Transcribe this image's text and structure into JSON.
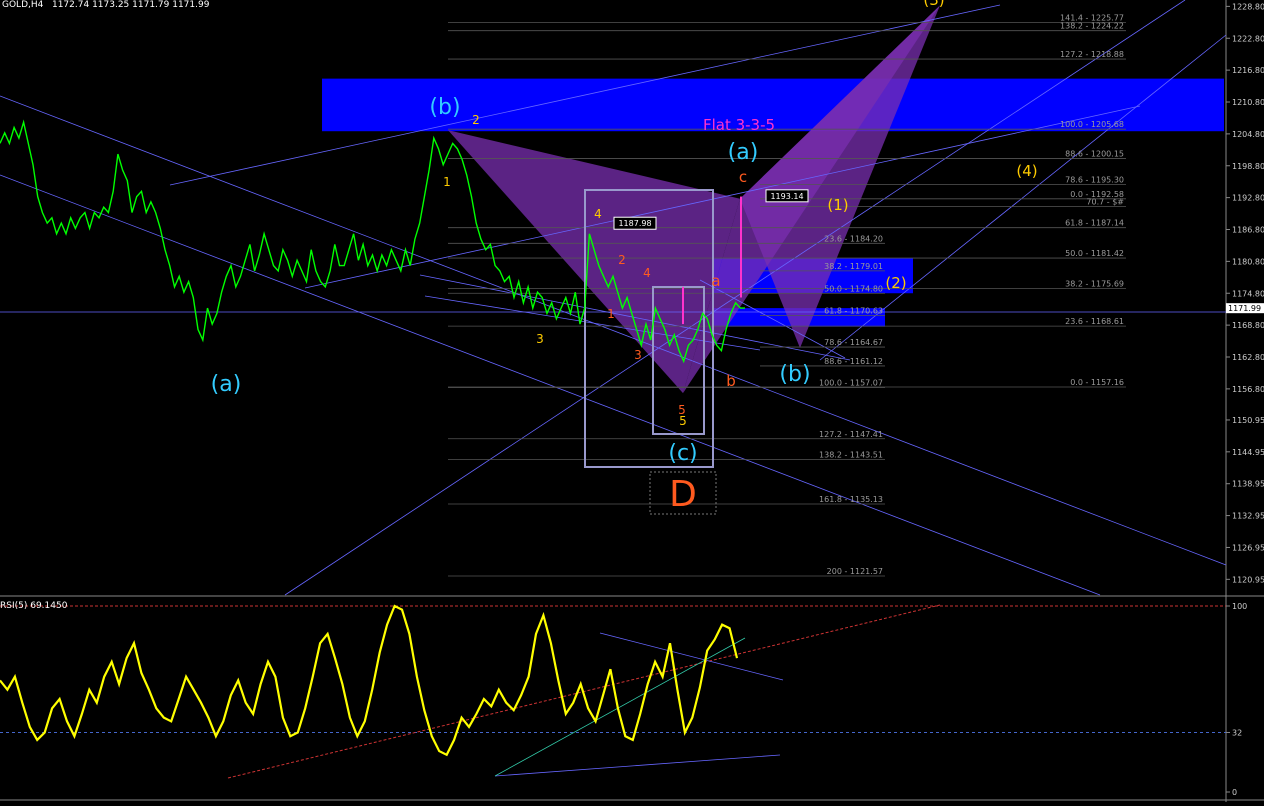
{
  "header": {
    "symbol": "GOLD,H4",
    "ohlc": "1172.74 1173.25 1171.79 1171.99"
  },
  "rsi_header": "RSI(5) 69.1450",
  "colors": {
    "background": "#000000",
    "price_line": "#00ff00",
    "rsi_line": "#ffff00",
    "trendline": "#6666ff",
    "harmonic_fill": "#7a2fb0",
    "supply_zone": "#0000ff",
    "fib_line": "#555555",
    "cyan_label": "#33ccff",
    "orange_label": "#ff5a1f",
    "yellow_label": "#ffcc00",
    "magenta_label": "#ff33cc"
  },
  "chart_data": [
    {
      "type": "line",
      "panel": "price",
      "ylim": [
        1118,
        1230
      ],
      "y_ticks": [
        "1228.80",
        "1222.80",
        "1216.80",
        "1210.80",
        "1204.80",
        "1198.80",
        "1192.80",
        "1186.80",
        "1180.80",
        "1174.80",
        "1168.80",
        "1162.80",
        "1156.80",
        "1150.95",
        "1144.95",
        "1138.95",
        "1132.95",
        "1126.95",
        "1120.95"
      ],
      "current_price": "1171.99",
      "series": [
        {
          "values": [
            1203,
            1205,
            1203,
            1206,
            1204,
            1207,
            1203,
            1199,
            1193,
            1190,
            1188,
            1189,
            1186,
            1188,
            1186,
            1189,
            1187,
            1189,
            1190,
            1187,
            1190,
            1189,
            1191,
            1190,
            1194,
            1201,
            1198,
            1196,
            1190,
            1193,
            1194,
            1190,
            1192,
            1190,
            1187,
            1183,
            1180,
            1176,
            1178,
            1175,
            1177,
            1174,
            1168,
            1166,
            1172,
            1169,
            1171,
            1175,
            1178,
            1180,
            1176,
            1178,
            1181,
            1184,
            1179,
            1182,
            1186,
            1183,
            1180,
            1179,
            1183,
            1181,
            1178,
            1181,
            1179,
            1177,
            1183,
            1179,
            1177,
            1176,
            1179,
            1184,
            1180,
            1180,
            1183,
            1186,
            1181,
            1184,
            1180,
            1182,
            1179,
            1182,
            1180,
            1183,
            1181,
            1179,
            1183,
            1180,
            1185,
            1188,
            1193,
            1198,
            1204,
            1202,
            1199,
            1201,
            1203,
            1202,
            1200,
            1197,
            1193,
            1188,
            1185,
            1183,
            1184,
            1180,
            1179,
            1177,
            1178,
            1174,
            1177,
            1173,
            1176,
            1172,
            1175,
            1174,
            1171,
            1173,
            1170,
            1172,
            1174,
            1171,
            1175,
            1169,
            1172,
            1186,
            1183,
            1180,
            1178,
            1176,
            1178,
            1175,
            1172,
            1174,
            1171,
            1168,
            1165,
            1169,
            1166,
            1172,
            1170,
            1168,
            1165,
            1167,
            1164,
            1162,
            1165,
            1166,
            1168,
            1171,
            1170,
            1167,
            1165,
            1164,
            1168,
            1171,
            1173,
            1172,
            1172
          ]
        }
      ],
      "fib_levels": [
        {
          "label": "141.4 - 1225.77",
          "value": 1225.77
        },
        {
          "label": "138.2 - 1224.22",
          "value": 1224.22
        },
        {
          "label": "127.2 - 1218.88",
          "value": 1218.88
        },
        {
          "label": "100.0 - 1205.68",
          "value": 1205.68
        },
        {
          "label": "88.6 - 1200.15",
          "value": 1200.15
        },
        {
          "label": "78.6 - 1195.30",
          "value": 1195.3
        },
        {
          "label": "0.0 - 1192.58",
          "value": 1192.58
        },
        {
          "label": "70.7 - $#",
          "value": 1191.1
        },
        {
          "label": "61.8 - 1187.14",
          "value": 1187.14
        },
        {
          "label": "23.6 - 1184.20",
          "value": 1184.2
        },
        {
          "label": "50.0 - 1181.42",
          "value": 1181.42
        },
        {
          "label": "38.2 - 1179.01",
          "value": 1179.01
        },
        {
          "label": "38.2 - 1175.69",
          "value": 1175.69
        },
        {
          "label": "50.0 - 1174.80",
          "value": 1174.8
        },
        {
          "label": "61.8 - 1170.63",
          "value": 1170.63
        },
        {
          "label": "23.6 - 1168.61",
          "value": 1168.61
        },
        {
          "label": "78.6 - 1164.67",
          "value": 1164.67
        },
        {
          "label": "88.6 - 1161.12",
          "value": 1161.12
        },
        {
          "label": "100.0 - 1157.07",
          "value": 1157.07
        },
        {
          "label": "0.0 - 1157.16",
          "value": 1157.16
        },
        {
          "label": "127.2 - 1147.41",
          "value": 1147.41
        },
        {
          "label": "138.2 - 1143.51",
          "value": 1143.51
        },
        {
          "label": "161.8 - 1135.13",
          "value": 1135.13
        },
        {
          "label": "200 - 1121.57",
          "value": 1121.57
        }
      ],
      "price_boxes": [
        {
          "label": "1187.98",
          "value": 1187.98
        },
        {
          "label": "1193.14",
          "value": 1193.14
        }
      ],
      "annotations": [
        {
          "text": "(b)",
          "color": "cyan",
          "size": "big"
        },
        {
          "text": "(a)",
          "color": "cyan",
          "size": "big"
        },
        {
          "text": "(a)",
          "color": "cyan",
          "size": "big"
        },
        {
          "text": "(b)",
          "color": "cyan",
          "size": "big"
        },
        {
          "text": "(c)",
          "color": "cyan",
          "size": "big"
        },
        {
          "text": "Flat 3-3-5",
          "color": "magenta",
          "size": "mid"
        },
        {
          "text": "D",
          "color": "orange",
          "size": "huge"
        },
        {
          "text": "c",
          "color": "orange",
          "size": "mid"
        },
        {
          "text": "a",
          "color": "orange",
          "size": "mid"
        },
        {
          "text": "b",
          "color": "orange",
          "size": "mid"
        },
        {
          "text": "(1)",
          "color": "yellow",
          "size": "mid"
        },
        {
          "text": "(2)",
          "color": "yellow",
          "size": "mid"
        },
        {
          "text": "(3)",
          "color": "yellow",
          "size": "mid"
        },
        {
          "text": "(4)",
          "color": "yellow",
          "size": "mid"
        },
        {
          "text": "1",
          "color": "yellow",
          "size": "small"
        },
        {
          "text": "2",
          "color": "yellow",
          "size": "small"
        },
        {
          "text": "3",
          "color": "yellow",
          "size": "small"
        },
        {
          "text": "4",
          "color": "yellow",
          "size": "small"
        },
        {
          "text": "5",
          "color": "yellow",
          "size": "small"
        },
        {
          "text": "1",
          "color": "orange",
          "size": "small"
        },
        {
          "text": "2",
          "color": "orange",
          "size": "small"
        },
        {
          "text": "3",
          "color": "orange",
          "size": "small"
        },
        {
          "text": "4",
          "color": "orange",
          "size": "small"
        },
        {
          "text": "5",
          "color": "orange",
          "size": "small"
        }
      ]
    },
    {
      "type": "line",
      "panel": "rsi",
      "ylim": [
        0,
        100
      ],
      "y_ticks": [
        "100",
        "32",
        "0"
      ],
      "levels": [
        32
      ],
      "series": [
        {
          "name": "RSI(5)",
          "values": [
            60,
            55,
            62,
            48,
            35,
            28,
            32,
            45,
            50,
            38,
            30,
            42,
            55,
            48,
            62,
            70,
            58,
            72,
            80,
            64,
            55,
            45,
            40,
            38,
            50,
            62,
            55,
            48,
            40,
            30,
            38,
            52,
            60,
            48,
            42,
            58,
            70,
            62,
            40,
            30,
            32,
            45,
            62,
            80,
            85,
            72,
            58,
            40,
            30,
            38,
            55,
            75,
            90,
            100,
            98,
            85,
            62,
            44,
            30,
            22,
            20,
            28,
            40,
            35,
            42,
            50,
            46,
            55,
            48,
            44,
            52,
            62,
            85,
            95,
            80,
            60,
            42,
            48,
            58,
            45,
            38,
            52,
            66,
            45,
            30,
            28,
            42,
            58,
            70,
            62,
            80,
            55,
            32,
            40,
            56,
            76,
            82,
            90,
            88,
            72
          ]
        }
      ]
    }
  ]
}
